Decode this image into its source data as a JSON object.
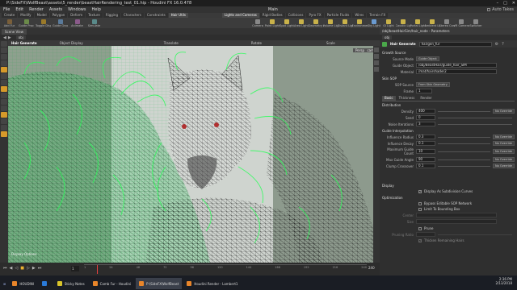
{
  "window": {
    "title": "P:\\SideFX\\WolfBeast\\assets\\5_render\\beastHairRendering_test_01.hip - Houdini FX 16.0.478",
    "controls": [
      "–",
      "□",
      "✕"
    ]
  },
  "menu": {
    "items": [
      "File",
      "Edit",
      "Render",
      "Assets",
      "Windows",
      "Help"
    ],
    "auto_takes": "Auto Takes",
    "main": "Main"
  },
  "shelf": {
    "tabs": [
      "Create",
      "Modify",
      "Model",
      "Polygon",
      "Deform",
      "Texture",
      "Rigging",
      "Characters",
      "Constraints",
      "Hair Utils"
    ],
    "active_tab": 9,
    "right_tabs": [
      "Lights and Cameras",
      "Rigid Bodies",
      "Collisions",
      "Pyro FX",
      "Particle Fluids",
      "Wires",
      "Terrain FX"
    ],
    "tools": [
      {
        "label": "Add Fur",
        "color": "#7a5f3a"
      },
      {
        "label": "Guide Process",
        "color": "#6b8a4a"
      },
      {
        "label": "Toggle Display",
        "color": "#9a7a2a"
      },
      {
        "label": "Guide Groom",
        "color": "#5a7a9a"
      },
      {
        "label": "Animate",
        "color": "#8a5a8a"
      },
      {
        "label": "Simulate",
        "color": "#5a8a8a"
      }
    ],
    "right_tools": [
      {
        "label": "Camera",
        "color": "#888"
      },
      {
        "label": "Point Light",
        "color": "#c9b24a"
      },
      {
        "label": "Spot Light",
        "color": "#c9b24a"
      },
      {
        "label": "Area Light",
        "color": "#c9b24a"
      },
      {
        "label": "Geometry Light",
        "color": "#c9b24a"
      },
      {
        "label": "Volume Light",
        "color": "#c9b24a"
      },
      {
        "label": "Distant Light",
        "color": "#c9b24a"
      },
      {
        "label": "Environment Light",
        "color": "#c9b24a"
      },
      {
        "label": "Sky Light",
        "color": "#6a9ad0"
      },
      {
        "label": "GI Light",
        "color": "#c9b24a"
      },
      {
        "label": "Caustic Light",
        "color": "#c9b24a"
      },
      {
        "label": "Portal Light",
        "color": "#c9b24a"
      },
      {
        "label": "Ambient Light",
        "color": "#c9b24a"
      },
      {
        "label": "Stereo Camera",
        "color": "#888"
      },
      {
        "label": "VR Camera",
        "color": "#888"
      },
      {
        "label": "Switcher",
        "color": "#888"
      }
    ]
  },
  "panes": {
    "left_tab": "Scene View",
    "right_tab": "/obj/beastHairSim/hair_node - Parameters",
    "path_left": "obj",
    "path_right": "obj"
  },
  "viewport": {
    "node_label": "Hair Generate",
    "view_label": "Object Display",
    "transform_label": "Translate",
    "rotate_label": "Rotate",
    "scale_label": "Scale",
    "persp_button": "Persp",
    "cam_button": "cam",
    "overlay_note": "Display Options"
  },
  "timeline": {
    "frame": "1",
    "ticks": [
      "1",
      "24",
      "48",
      "72",
      "96",
      "120",
      "144",
      "168",
      "192",
      "216",
      "240"
    ],
    "end_frame": "240"
  },
  "params": {
    "node_type": "Hair Generate",
    "node_name": "hairgen_fur",
    "section_growth": "Growth Source",
    "source_mode_label": "Source Mode",
    "source_mode_value": "Guide Object",
    "guide_object_label": "Guide Object",
    "guide_object_value": "/obj/BeastHair/guide_hair_SIM",
    "material_label": "Material",
    "material_value": "/mat/hairshader2",
    "section_skin": "Skin SOP",
    "sop_source_label": "SOP Source",
    "sop_source_value": "From Skin Geometry",
    "frame_label": "Frame",
    "frame_value": "1",
    "tabs": [
      "Basic",
      "Thickness",
      "Render"
    ],
    "active_tab": 0,
    "section_distribution": "Distribution",
    "density_label": "Density",
    "density_value": "400",
    "seed_label": "Seed",
    "seed_value": "0",
    "noise_label": "Noise Iterations",
    "noise_value": "3",
    "override": "No Override",
    "section_interp": "Guide Interpolation",
    "infl_radius_label": "Influence Radius",
    "infl_radius_value": "0.3",
    "infl_decay_label": "Influence Decay",
    "infl_decay_value": "0.1",
    "max_guide_label": "Maximum Guide Count",
    "max_guide_value": "10",
    "max_angle_label": "Max Guide Angle",
    "max_angle_value": "90",
    "clump_label": "Clump Crossover",
    "clump_value": "0.1",
    "section_display": "Display",
    "display_sub_label": "Display As Subdivision Curves",
    "section_opt": "Optimization",
    "bypass_label": "Bypass Editable SOP Network",
    "limit_bbox_label": "Limit To Bounding Box",
    "center_label": "Center",
    "size_label": "Size",
    "prune_label": "Prune",
    "pruning_ratio_label": "Pruning Ratio",
    "thicken_label": "Thicken Remaining Hairs"
  },
  "taskbar": {
    "items": [
      {
        "label": "HOUDINI",
        "color": "#e8852a"
      },
      {
        "label": "",
        "color": "#2a7ad8"
      },
      {
        "label": "Sticky Notes",
        "color": "#d8c32a"
      },
      {
        "label": "Comb Fur - Houdini",
        "color": "#e8852a"
      },
      {
        "label": "P:\\SideFX\\WolfBeast",
        "color": "#e8852a"
      },
      {
        "label": "Houdini Render - Lambert1",
        "color": "#e8852a"
      }
    ],
    "active": 4,
    "time": "2:36 PM",
    "date": "2/13/2018"
  }
}
